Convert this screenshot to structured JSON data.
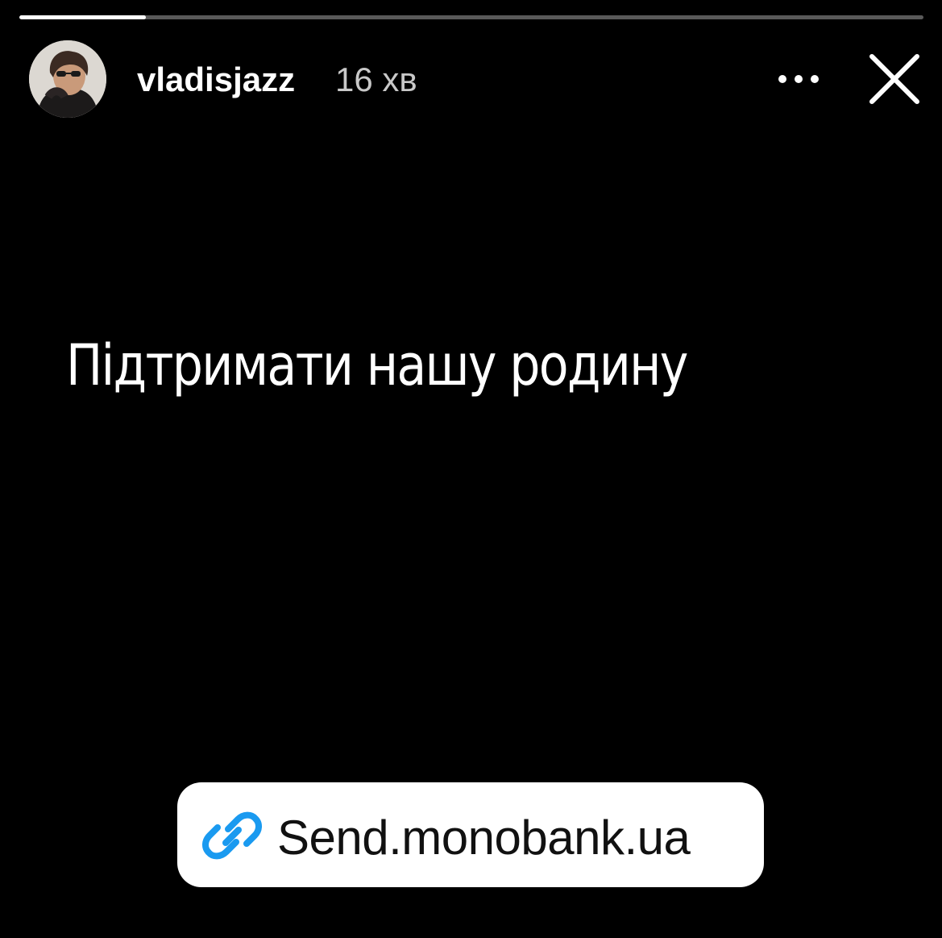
{
  "story": {
    "progress": 0.14
  },
  "header": {
    "username": "vladisjazz",
    "time": "16 хв",
    "avatar_icon": "user-avatar-photo",
    "more_icon": "more-horizontal-icon",
    "close_icon": "close-icon"
  },
  "content": {
    "text": "Підтримати нашу родину"
  },
  "link_sticker": {
    "label": "Send.monobank.ua",
    "icon": "link-icon",
    "icon_color": "#1a9af0"
  },
  "colors": {
    "background": "#000000",
    "text": "#ffffff",
    "secondary_text": "#c8c8c8",
    "sticker_background": "#ffffff",
    "link_accent": "#1a9af0"
  }
}
